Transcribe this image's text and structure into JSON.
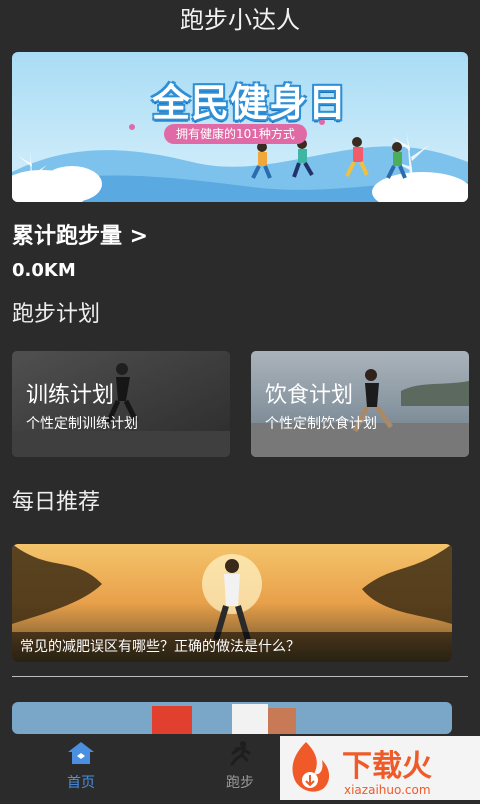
{
  "header": {
    "title": "跑步小达人"
  },
  "banner": {
    "title": "全民健身日",
    "subtitle": "拥有健康的101种方式"
  },
  "summary": {
    "total_label": "累计跑步量 >",
    "total_value": "0.0KM"
  },
  "plans": {
    "section_title": "跑步计划",
    "items": [
      {
        "name": "训练计划",
        "desc": "个性定制训练计划"
      },
      {
        "name": "饮食计划",
        "desc": "个性定制饮食计划"
      }
    ]
  },
  "recommend": {
    "section_title": "每日推荐",
    "items": [
      {
        "caption": "常见的减肥误区有哪些？正确的做法是什么？"
      }
    ]
  },
  "bottom_nav": {
    "items": [
      {
        "label": "首页",
        "icon": "home-icon",
        "active": true
      },
      {
        "label": "跑步",
        "icon": "runner-icon",
        "active": false
      }
    ]
  },
  "watermark": {
    "text": "下载火",
    "url_text": "xiazaihuo.com"
  },
  "colors": {
    "background": "#2b2b2b",
    "active_tab": "#4a8fe0",
    "inactive_tab": "#9a9a9a",
    "brand_orange": "#f05a28"
  }
}
